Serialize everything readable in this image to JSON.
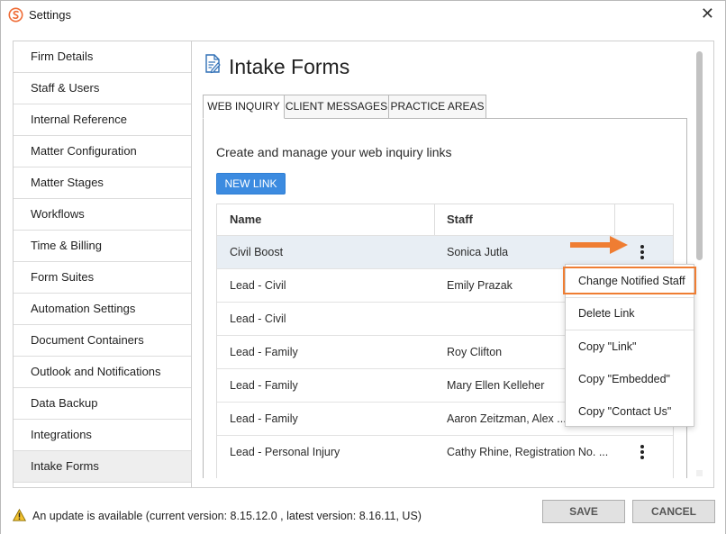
{
  "window": {
    "title": "Settings",
    "close_glyph": "✕"
  },
  "sidebar": {
    "items": [
      {
        "label": "Firm Details"
      },
      {
        "label": "Staff & Users"
      },
      {
        "label": "Internal Reference"
      },
      {
        "label": "Matter Configuration"
      },
      {
        "label": "Matter Stages"
      },
      {
        "label": "Workflows"
      },
      {
        "label": "Time & Billing"
      },
      {
        "label": "Form Suites"
      },
      {
        "label": "Automation Settings"
      },
      {
        "label": "Document Containers"
      },
      {
        "label": "Outlook and Notifications"
      },
      {
        "label": "Data Backup"
      },
      {
        "label": "Integrations"
      },
      {
        "label": "Intake Forms"
      }
    ],
    "active": "Intake Forms"
  },
  "page": {
    "title": "Intake Forms",
    "tabs": [
      {
        "label": "WEB INQUIRY"
      },
      {
        "label": "CLIENT MESSAGES"
      },
      {
        "label": "PRACTICE AREAS"
      }
    ],
    "description": "Create and manage your web inquiry links",
    "new_link_label": "NEW LINK"
  },
  "table": {
    "headers": {
      "name": "Name",
      "staff": "Staff"
    },
    "rows": [
      {
        "name": "Civil Boost",
        "staff": "Sonica Jutla"
      },
      {
        "name": "Lead - Civil",
        "staff": "Emily Prazak"
      },
      {
        "name": "Lead - Civil",
        "staff": ""
      },
      {
        "name": "Lead - Family",
        "staff": "Roy Clifton"
      },
      {
        "name": "Lead - Family",
        "staff": "Mary Ellen Kelleher"
      },
      {
        "name": "Lead - Family",
        "staff": "Aaron Zeitzman, Alex ..."
      },
      {
        "name": "Lead - Personal Injury",
        "staff": "Cathy Rhine, Registration No. ..."
      }
    ]
  },
  "context_menu": {
    "items": [
      {
        "label": "Change Notified Staff"
      },
      {
        "label": "Delete Link"
      },
      {
        "label": "Copy \"Link\""
      },
      {
        "label": "Copy \"Embedded\""
      },
      {
        "label": "Copy \"Contact Us\""
      }
    ]
  },
  "footer": {
    "update_message": "An update is available (current version: 8.15.12.0 , latest version: 8.16.11, US)",
    "save_label": "SAVE",
    "cancel_label": "CANCEL"
  },
  "colors": {
    "accent_button": "#3c8be0",
    "highlight_orange": "#ef7d32",
    "selected_row": "#e8eef4"
  }
}
